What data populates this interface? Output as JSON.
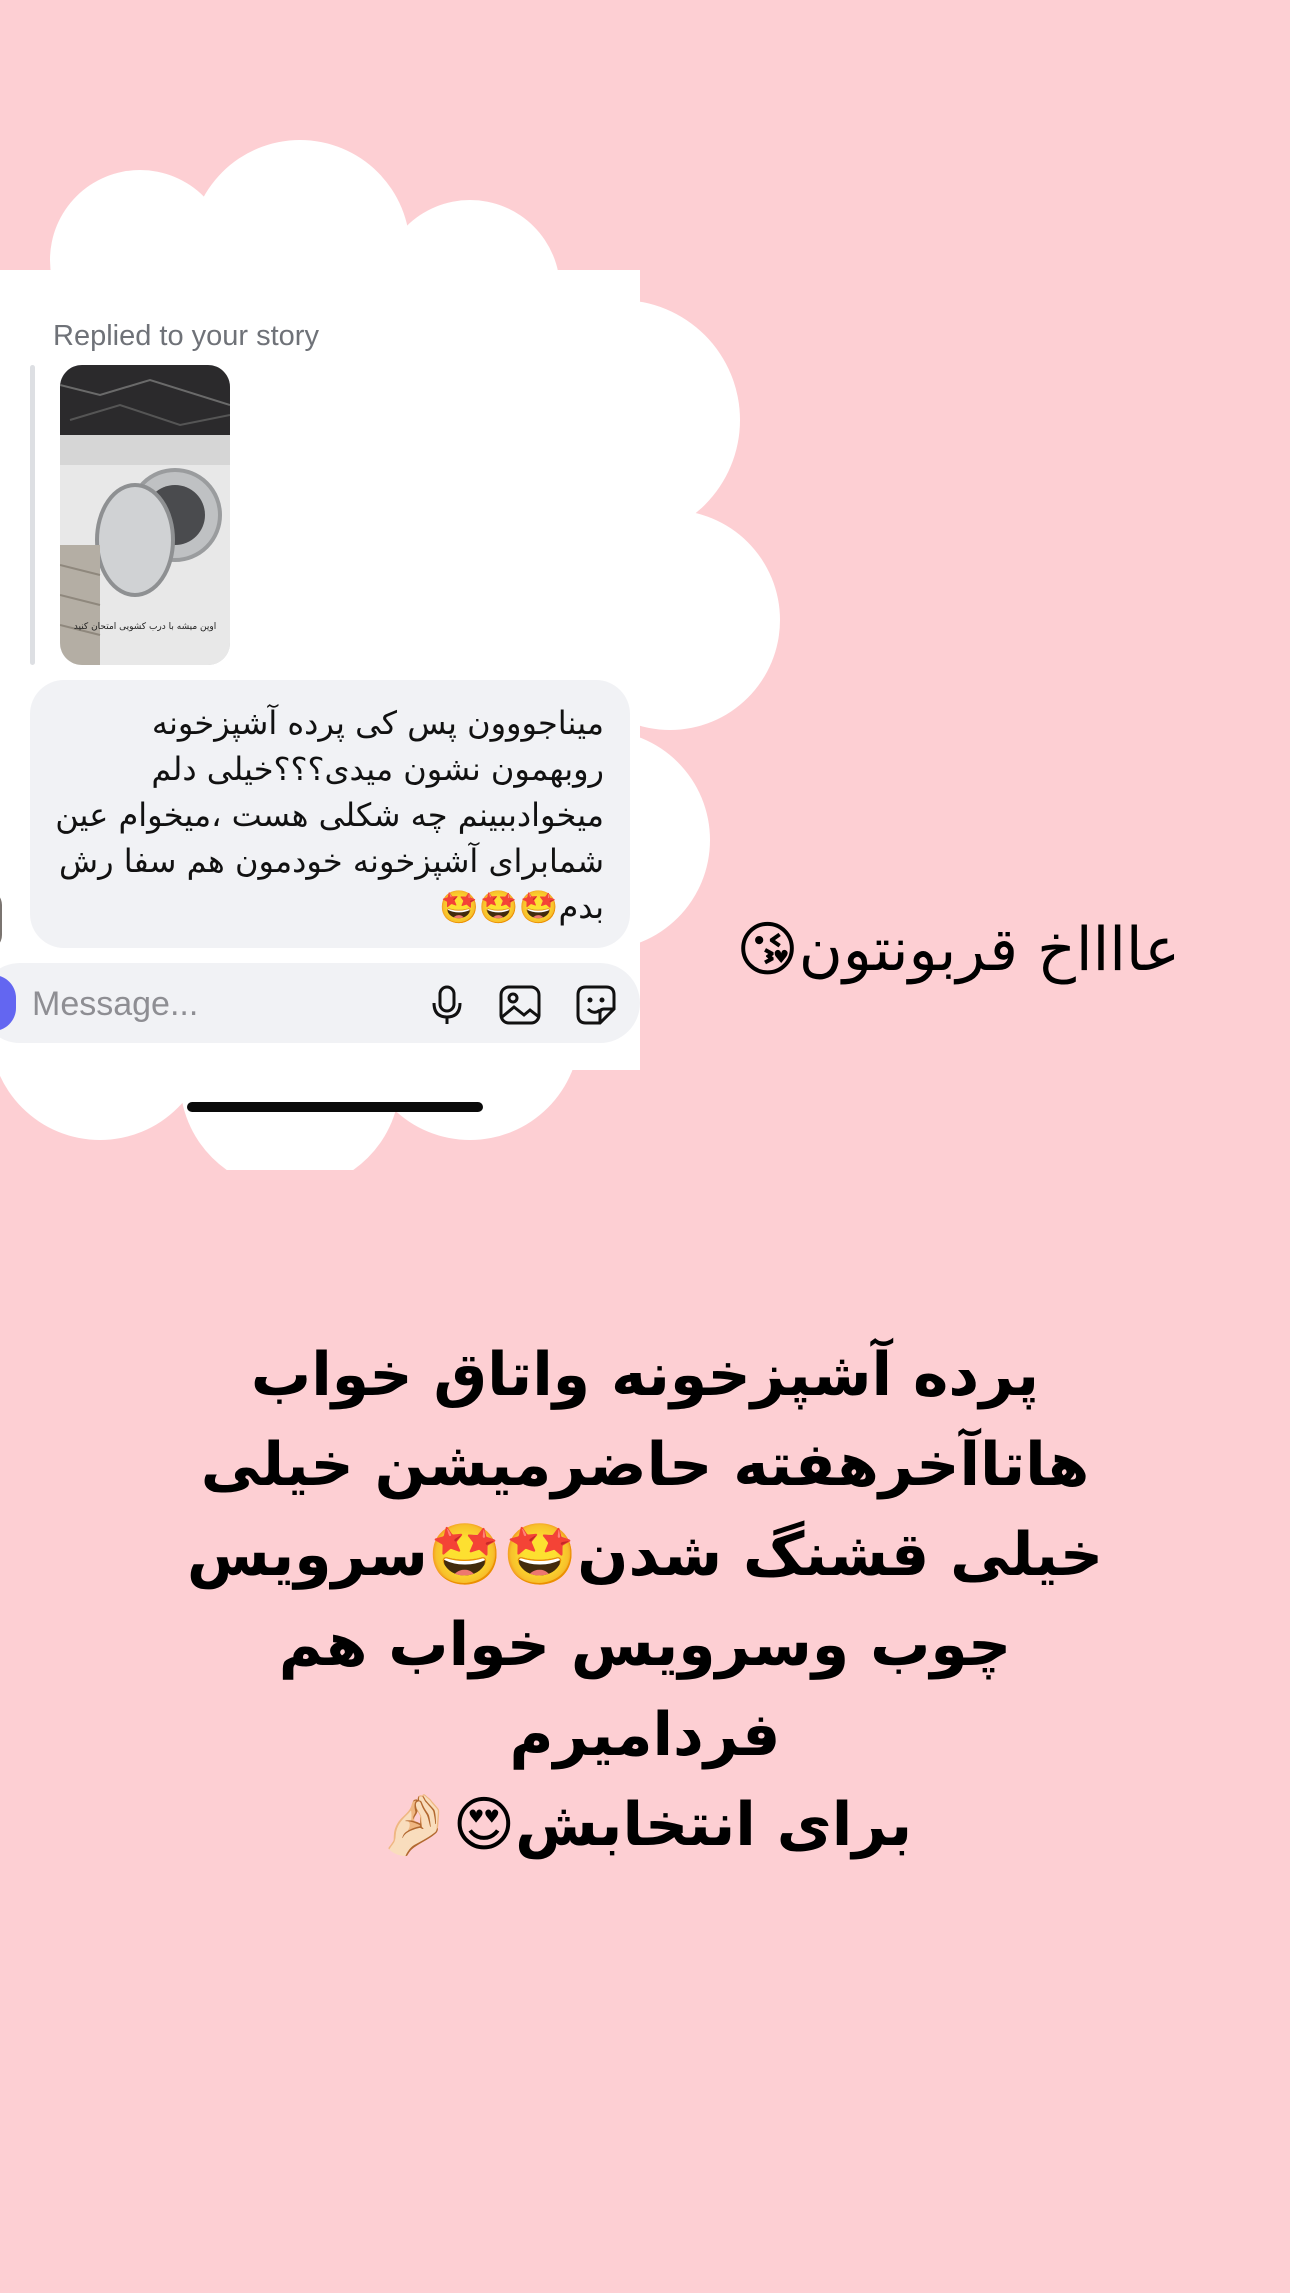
{
  "background_color": "#FDCFD3",
  "screenshot": {
    "replied_label": "Replied to your story",
    "story_caption": "اوپن میشه با درب کشویی امتحان کنید",
    "message_text": "میناجووون پس کی پرده آشپزخونه روبهمون نشون میدی؟؟؟خیلی دلم میخوادببینم چه شکلی هست ،میخوام عین شمابرای آشپزخونه خودمون هم سفا رش بدم🤩🤩🤩",
    "composer": {
      "placeholder": "Message...",
      "icons": [
        "microphone-icon",
        "gallery-icon",
        "sticker-icon"
      ],
      "accent_color": "#6366F1"
    }
  },
  "reply_caption": "عااااخ قربونتون😘",
  "main_caption_lines": [
    "پرده آشپزخونه واتاق خواب",
    "هاتاآخرهفته حاضرمیشن خیلی",
    "خیلی قشنگ شدن🤩🤩سرویس",
    "چوب وسرویس خواب هم فردامیرم",
    "برای انتخابش😍🤌🏻"
  ]
}
